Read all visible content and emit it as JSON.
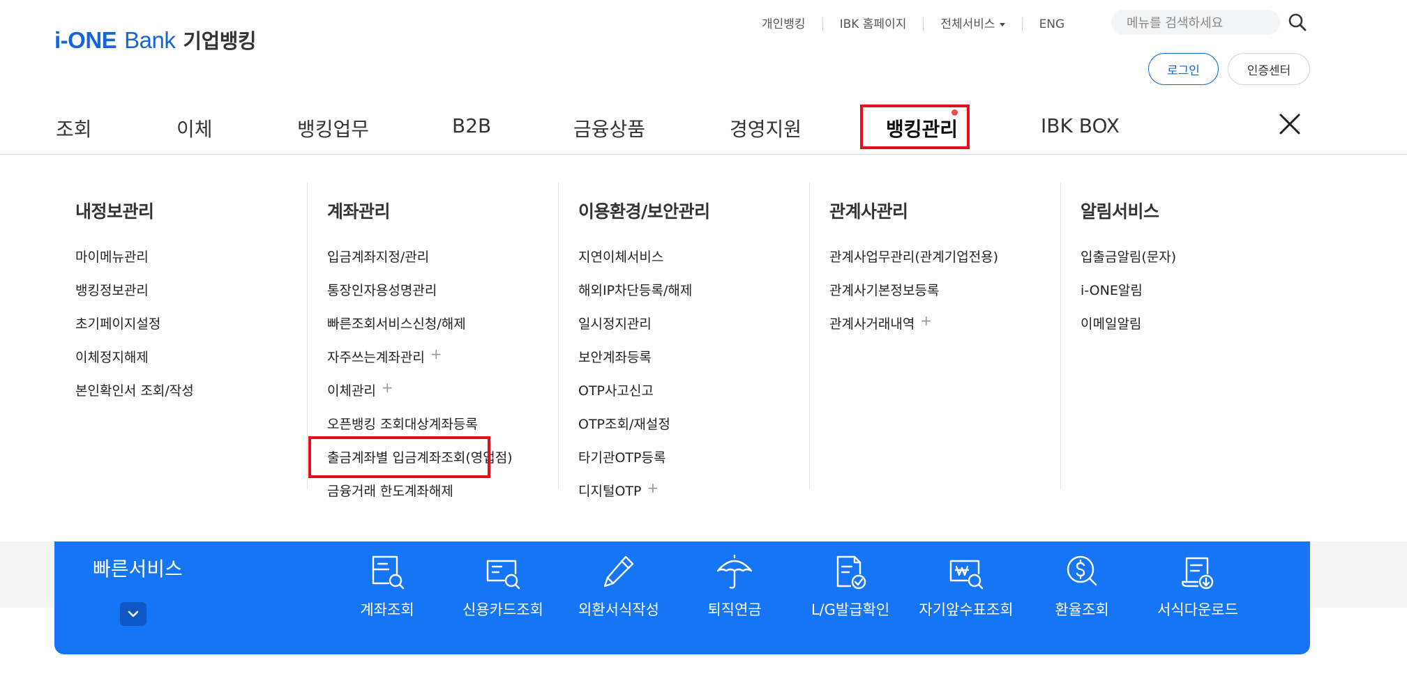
{
  "header": {
    "logo": {
      "part1": "i-ONE",
      "part2": "Bank",
      "part3": "기업뱅킹"
    },
    "util_links": [
      {
        "label": "개인뱅킹"
      },
      {
        "label": "IBK 홈페이지"
      },
      {
        "label": "전체서비스"
      },
      {
        "label": "ENG"
      }
    ],
    "search": {
      "placeholder": "메뉴를 검색하세요"
    },
    "login_label": "로그인",
    "cert_label": "인증센터"
  },
  "gnb": {
    "items": [
      {
        "label": "조회"
      },
      {
        "label": "이체"
      },
      {
        "label": "뱅킹업무"
      },
      {
        "label": "B2B"
      },
      {
        "label": "금융상품"
      },
      {
        "label": "경영지원"
      },
      {
        "label": "뱅킹관리"
      },
      {
        "label": "IBK BOX"
      }
    ],
    "active_index": 6
  },
  "menu": {
    "columns": [
      {
        "title": "내정보관리",
        "items": [
          {
            "label": "마이메뉴관리"
          },
          {
            "label": "뱅킹정보관리"
          },
          {
            "label": "초기페이지설정"
          },
          {
            "label": "이체정지해제"
          },
          {
            "label": "본인확인서 조회/작성"
          }
        ]
      },
      {
        "title": "계좌관리",
        "items": [
          {
            "label": "입금계좌지정/관리"
          },
          {
            "label": "통장인자용성명관리"
          },
          {
            "label": "빠른조회서비스신청/해제"
          },
          {
            "label": "자주쓰는계좌관리",
            "plus": "+"
          },
          {
            "label": "이체관리",
            "plus": "+"
          },
          {
            "label": "오픈뱅킹 조회대상계좌등록"
          },
          {
            "label": "출금계좌별 입금계좌조회(영업점)"
          },
          {
            "label": "금융거래 한도계좌해제"
          }
        ]
      },
      {
        "title": "이용환경/보안관리",
        "items": [
          {
            "label": "지연이체서비스"
          },
          {
            "label": "해외IP차단등록/해제"
          },
          {
            "label": "일시정지관리"
          },
          {
            "label": "보안계좌등록"
          },
          {
            "label": "OTP사고신고"
          },
          {
            "label": "OTP조회/재설정"
          },
          {
            "label": "타기관OTP등록"
          },
          {
            "label": "디지털OTP",
            "plus": "+"
          }
        ]
      },
      {
        "title": "관계사관리",
        "items": [
          {
            "label": "관계사업무관리(관계기업전용)"
          },
          {
            "label": "관계사기본정보등록"
          },
          {
            "label": "관계사거래내역",
            "plus": "+"
          }
        ]
      },
      {
        "title": "알림서비스",
        "items": [
          {
            "label": "입출금알림(문자)"
          },
          {
            "label": "i-ONE알림"
          },
          {
            "label": "이메일알림"
          }
        ]
      }
    ]
  },
  "quick_service": {
    "title": "빠른서비스",
    "items": [
      {
        "label": "계좌조회",
        "icon": "account-inquiry-icon"
      },
      {
        "label": "신용카드조회",
        "icon": "credit-card-inquiry-icon"
      },
      {
        "label": "외환서식작성",
        "icon": "forex-form-pen-icon"
      },
      {
        "label": "퇴직연금",
        "icon": "umbrella-icon"
      },
      {
        "label": "L/G발급확인",
        "icon": "lg-document-check-icon"
      },
      {
        "label": "자기앞수표조회",
        "icon": "check-inquiry-icon"
      },
      {
        "label": "환율조회",
        "icon": "exchange-rate-icon"
      },
      {
        "label": "서식다운로드",
        "icon": "form-download-icon"
      }
    ]
  },
  "colors": {
    "brand_blue": "#1575f4",
    "logo_blue": "#1565d8",
    "highlight_red": "#e0111b"
  }
}
